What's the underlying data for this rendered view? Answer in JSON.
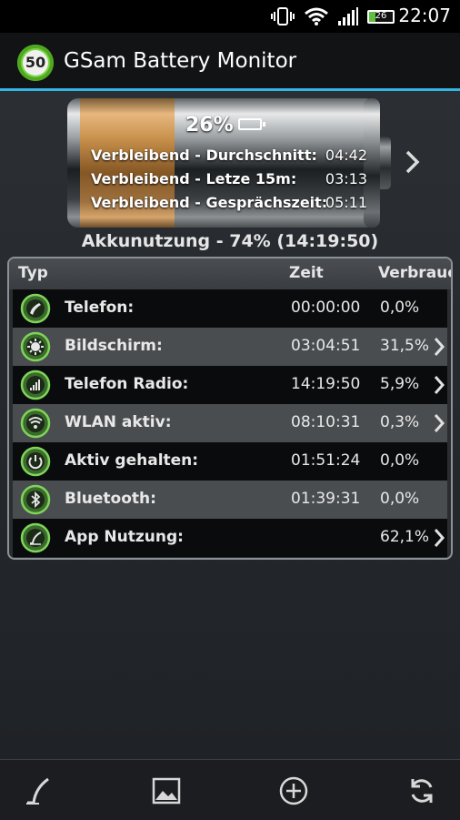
{
  "status_bar": {
    "time": "22:07",
    "battery_level": "26",
    "icons": [
      "vibrate-icon",
      "wifi-icon",
      "signal-icon",
      "battery-icon"
    ]
  },
  "app": {
    "logo_text": "50",
    "title": "GSam Battery Monitor"
  },
  "battery": {
    "percent": "26%",
    "fill_fraction": 0.26,
    "stats": [
      {
        "label": "Verbleibend - Durchschnitt:",
        "value": "04:42"
      },
      {
        "label": "Verbleibend - Letze 15m:",
        "value": "03:13"
      },
      {
        "label": "Verbleibend - Gesprächszeit:",
        "value": "05:11"
      }
    ]
  },
  "usage_text": "Akkunutzung - 74% (14:19:50)",
  "table": {
    "headers": {
      "type": "Typ",
      "time": "Zeit",
      "usage": "Verbrauch"
    },
    "rows": [
      {
        "name": "Telefon:",
        "time": "00:00:00",
        "pct": "0,0%",
        "icon": "phone-icon",
        "chevron": false
      },
      {
        "name": "Bildschirm:",
        "time": "03:04:51",
        "pct": "31,5%",
        "icon": "brightness-icon",
        "chevron": true
      },
      {
        "name": "Telefon Radio:",
        "time": "14:19:50",
        "pct": "5,9%",
        "icon": "signal-bars-icon",
        "chevron": true
      },
      {
        "name": "WLAN aktiv:",
        "time": "08:10:31",
        "pct": "0,3%",
        "icon": "wifi-icon",
        "chevron": true
      },
      {
        "name": "Aktiv gehalten:",
        "time": "01:51:24",
        "pct": "0,0%",
        "icon": "power-icon",
        "chevron": false
      },
      {
        "name": "Bluetooth:",
        "time": "01:39:31",
        "pct": "0,0%",
        "icon": "bluetooth-icon",
        "chevron": false
      },
      {
        "name": "App Nutzung:",
        "time": "",
        "pct": "62,1%",
        "icon": "app-usage-icon",
        "chevron": true
      }
    ]
  },
  "bottom_bar": [
    "graph-icon",
    "image-icon",
    "add-icon",
    "refresh-icon"
  ],
  "colors": {
    "accent": "#33b5e5",
    "icon_green": "#5fc040",
    "battery_fill": "#c98e45"
  }
}
